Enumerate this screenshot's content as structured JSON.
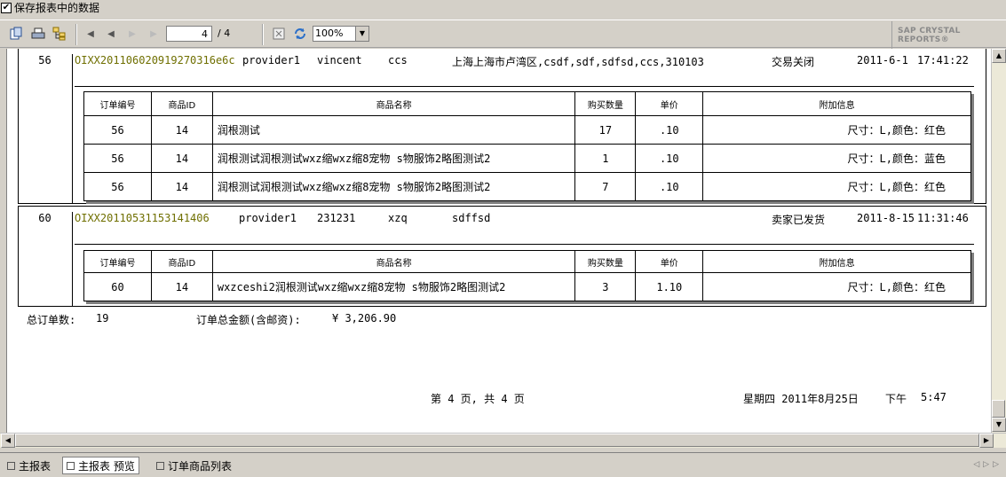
{
  "topbar": {
    "save_label": "保存报表中的数据",
    "checked_mark": "✔"
  },
  "toolbar": {
    "current_page": "4",
    "total_pages": "/ 4",
    "zoom": "100%",
    "brand": "SAP CRYSTAL REPORTS®"
  },
  "orders": [
    {
      "order_no": "56",
      "order_id": "OIXX20110602091927031​6e6c",
      "provider": "provider1",
      "buyer": "vincent",
      "receiver": "ccs",
      "address": "上海上海市卢湾区,csdf,sdf,sdfsd,ccs,310103",
      "status": "交易关闭",
      "date": "2011-6-1",
      "time": "17:41:22",
      "items": [
        {
          "no": "56",
          "pid": "14",
          "name": "润根测试",
          "qty": "17",
          "price": ".10",
          "extra": "尺寸：L,颜色：红色"
        },
        {
          "no": "56",
          "pid": "14",
          "name": "润根测试润根测试wxz缩wxz缩8宠物 s物服饰2略图测试2",
          "qty": "1",
          "price": ".10",
          "extra": "尺寸：L,颜色：蓝色"
        },
        {
          "no": "56",
          "pid": "14",
          "name": "润根测试润根测试wxz缩wxz缩8宠物 s物服饰2略图测试2",
          "qty": "7",
          "price": ".10",
          "extra": "尺寸：L,颜色：红色"
        }
      ]
    },
    {
      "order_no": "60",
      "order_id": "OIXX20110531153141406",
      "provider": "provider1",
      "buyer": "231231",
      "receiver": "xzq",
      "address": "sdffsd",
      "status": "卖家已发货",
      "date": "2011-8-15",
      "time": "11:31:46",
      "items": [
        {
          "no": "60",
          "pid": "14",
          "name": "wxzceshi2润根测试wxz缩wxz缩8宠物 s物服饰2略图测试2",
          "qty": "3",
          "price": "1.10",
          "extra": "尺寸：L,颜色：红色"
        }
      ]
    }
  ],
  "item_headers": {
    "no": "订单编号",
    "pid": "商品ID",
    "name": "商品名称",
    "qty": "购买数量",
    "price": "单价",
    "extra": "附加信息"
  },
  "summary": {
    "count_label": "总订单数:",
    "count_value": "19",
    "total_label": "订单总金额(含邮资):",
    "total_value": "¥ 3,206.90"
  },
  "footer": {
    "page_info": "第 4 页, 共 4 页",
    "weekday_date": "星期四 2011年8月25日",
    "ampm": "下午",
    "clock": "5:47"
  },
  "tabs": [
    {
      "label": "主报表"
    },
    {
      "label": "主报表 预览"
    },
    {
      "label": "订单商品列表"
    }
  ]
}
